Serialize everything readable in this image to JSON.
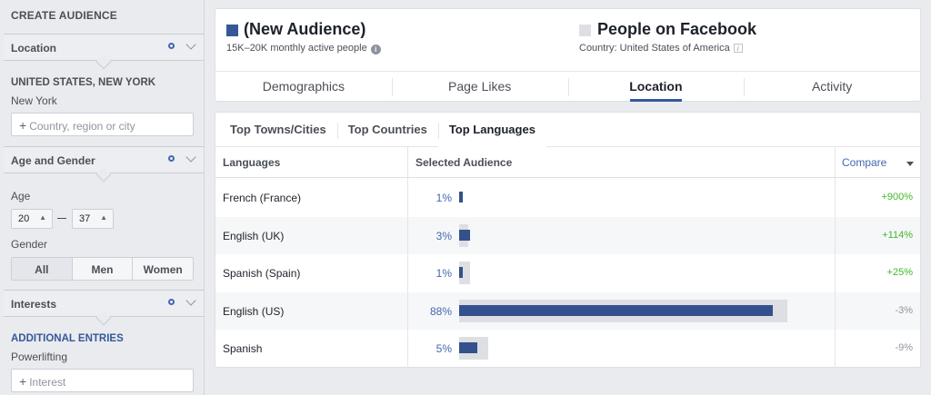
{
  "sidebar": {
    "title": "CREATE AUDIENCE",
    "location": {
      "header": "Location",
      "country": "UNITED STATES, NEW YORK",
      "region": "New York",
      "input_placeholder": "Country, region or city"
    },
    "age_gender": {
      "header": "Age and Gender",
      "age_label": "Age",
      "age_min": "20",
      "age_max": "37",
      "gender_label": "Gender",
      "gender_options": [
        "All",
        "Men",
        "Women"
      ],
      "gender_selected": "All"
    },
    "interests": {
      "header": "Interests",
      "additional_label": "ADDITIONAL ENTRIES",
      "entry": "Powerlifting",
      "input_placeholder": "Interest"
    }
  },
  "header": {
    "audience_name": "(New Audience)",
    "audience_sub": "15K–20K monthly active people",
    "audience_color": "#365899",
    "compare_name": "People on Facebook",
    "compare_sub": "Country: United States of America",
    "compare_color": "#dddfe2"
  },
  "tabs": [
    "Demographics",
    "Page Likes",
    "Location",
    "Activity"
  ],
  "active_tab": "Location",
  "subtabs": [
    "Top Towns/Cities",
    "Top Countries",
    "Top Languages"
  ],
  "active_subtab": "Top Languages",
  "table": {
    "headers": {
      "col1": "Languages",
      "col2": "Selected Audience",
      "col3": "Compare"
    },
    "rows": [
      {
        "language": "French (France)",
        "pct_label": "1%",
        "selected": 1,
        "baseline": 0,
        "compare": "+900%"
      },
      {
        "language": "English (UK)",
        "pct_label": "3%",
        "selected": 3,
        "baseline": 0.5,
        "compare": "+114%"
      },
      {
        "language": "Spanish (Spain)",
        "pct_label": "1%",
        "selected": 1,
        "baseline": 1,
        "compare": "+25%"
      },
      {
        "language": "English (US)",
        "pct_label": "88%",
        "selected": 88,
        "baseline": 90,
        "compare": "-3%"
      },
      {
        "language": "Spanish",
        "pct_label": "5%",
        "selected": 5,
        "baseline": 6,
        "compare": "-9%"
      }
    ]
  }
}
